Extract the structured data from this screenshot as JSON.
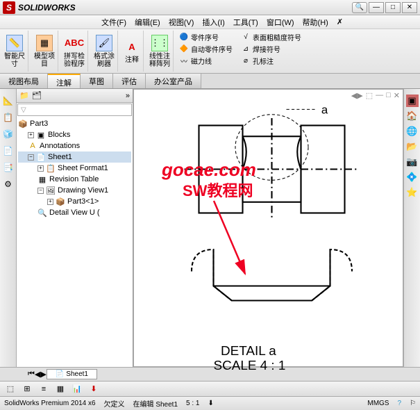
{
  "app": {
    "brand": "SOLIDWORKS",
    "logo": "S"
  },
  "menubar": [
    "文件(F)",
    "编辑(E)",
    "视图(V)",
    "插入(I)",
    "工具(T)",
    "窗口(W)",
    "帮助(H)",
    "✗"
  ],
  "ribbon": {
    "big": [
      {
        "l1": "智能尺",
        "l2": "寸"
      },
      {
        "l1": "模型项",
        "l2": "目"
      },
      {
        "l1": "拼写检",
        "l2": "验程序"
      },
      {
        "l1": "格式涂",
        "l2": "刷器"
      },
      {
        "l1": "注释",
        "l2": ""
      },
      {
        "l1": "线性注",
        "l2": "释阵列"
      }
    ],
    "col1": [
      "零件序号",
      "自动零件序号",
      "磁力线"
    ],
    "col2": [
      "表面粗糙度符号",
      "焊接符号",
      "孔标注"
    ]
  },
  "tabs": [
    "视图布局",
    "注解",
    "草图",
    "评估",
    "办公室产品"
  ],
  "tree": {
    "root": "Part3",
    "items": [
      "Blocks",
      "Annotations",
      "Sheet1",
      "Sheet Format1",
      "Revision Table",
      "Drawing View1",
      "Part3<1>",
      "Detail View U ("
    ]
  },
  "drawing": {
    "label_a": "a",
    "detail1": "DETAIL a",
    "detail2": "SCALE 4 : 1"
  },
  "sheettab": "Sheet1",
  "status": {
    "app": "SolidWorks Premium 2014 x6",
    "s1": "欠定义",
    "s2": "在编辑 Sheet1",
    "s3": "5 : 1",
    "s4": "MMGS"
  },
  "watermark": {
    "line1": "gocae.com",
    "line2": "SW教程网"
  },
  "filter_placeholder": "▽"
}
